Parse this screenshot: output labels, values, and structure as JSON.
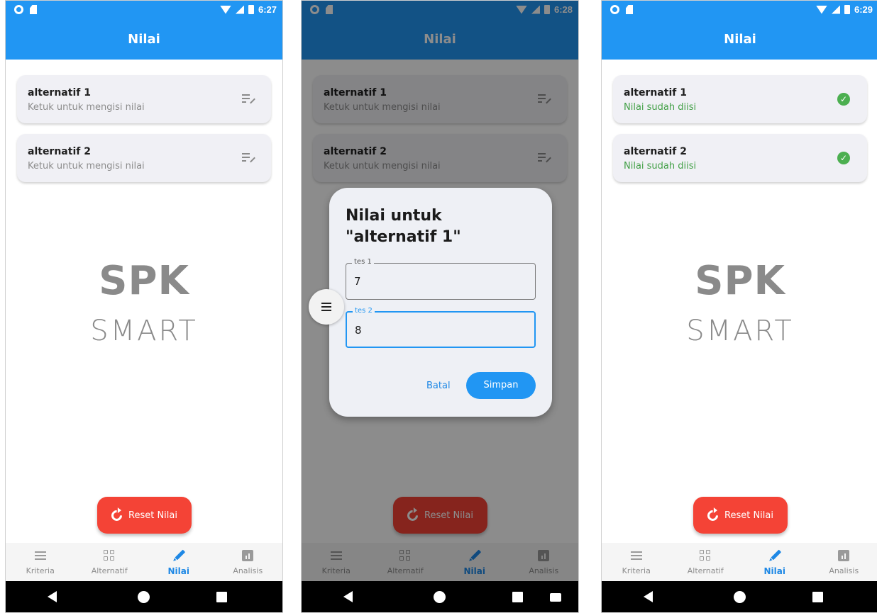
{
  "colors": {
    "primary": "#2196f3",
    "reset": "#f44336",
    "done": "#43a047",
    "active_nav": "#1e88e5"
  },
  "screens": [
    {
      "status_time": "6:27",
      "app_title": "Nilai",
      "items": [
        {
          "title": "alternatif 1",
          "subtitle": "Ketuk untuk mengisi nilai",
          "icon": "edit-note-icon"
        },
        {
          "title": "alternatif 2",
          "subtitle": "Ketuk untuk mengisi nilai",
          "icon": "edit-note-icon"
        }
      ],
      "logo_top": "SPK",
      "logo_bottom": "SMART",
      "reset_label": "Reset Nilai"
    },
    {
      "status_time": "6:28",
      "app_title": "Nilai",
      "items": [
        {
          "title": "alternatif 1",
          "subtitle": "Ketuk untuk mengisi nilai",
          "icon": "edit-note-icon"
        },
        {
          "title": "alternatif 2",
          "subtitle": "Ketuk untuk mengisi nilai",
          "icon": "edit-note-icon"
        }
      ],
      "reset_label": "Reset Nilai",
      "dialog": {
        "title": "Nilai untuk \"alternatif 1\"",
        "fields": [
          {
            "label": "tes 1",
            "value": "7"
          },
          {
            "label": "tes 2",
            "value": "8"
          }
        ],
        "cancel_label": "Batal",
        "save_label": "Simpan"
      }
    },
    {
      "status_time": "6:29",
      "app_title": "Nilai",
      "items": [
        {
          "title": "alternatif 1",
          "subtitle": "Nilai sudah diisi",
          "icon": "check-circle-icon"
        },
        {
          "title": "alternatif 2",
          "subtitle": "Nilai sudah diisi",
          "icon": "check-circle-icon"
        }
      ],
      "logo_top": "SPK",
      "logo_bottom": "SMART",
      "reset_label": "Reset Nilai"
    }
  ],
  "bottom_nav": [
    {
      "label": "Kriteria",
      "icon": "list-icon"
    },
    {
      "label": "Alternatif",
      "icon": "grid-icon"
    },
    {
      "label": "Nilai",
      "icon": "pencil-icon",
      "active": true
    },
    {
      "label": "Analisis",
      "icon": "chart-icon"
    }
  ]
}
